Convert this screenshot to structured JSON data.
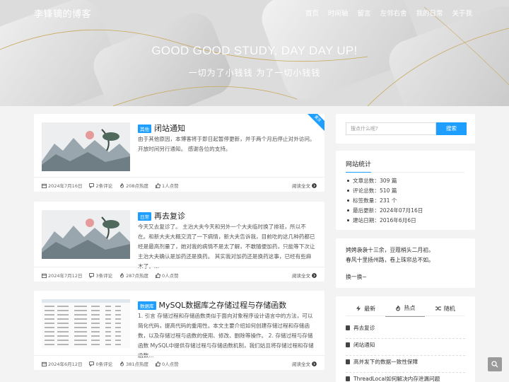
{
  "site": {
    "brand": "李锋镝的博客",
    "nav": [
      "首页",
      "时间轴",
      "留言",
      "左邻右舍",
      "我的日常",
      "关于我"
    ],
    "hero_title": "GOOD GOOD STUDY, DAY DAY UP!",
    "hero_subtitle": "一切为了小钱钱 为了一切小钱钱"
  },
  "posts": [
    {
      "category": "其他",
      "title": "闭站通知",
      "excerpt": "由于其他原因，本博客将于即日起暂停更新，并于两个月后停止对外访问。开放时间另行通知。 感谢各位的支持。",
      "date": "2024年7月16日",
      "comments": "2条评论",
      "heat": "208点热度",
      "likes": "1人点赞",
      "read_more": "阅读全文",
      "corner_badge": "置顶"
    },
    {
      "category": "日常",
      "title": "再去复诊",
      "excerpt": "今天又去复诊了。 主治大夫今天和另外一个大夫临时换了排班，所以不在。和新大夫大概交流了一下病情，新大夫告诉我，目前吃的这几种药都已经是最高剂量了，她对我的病情不是太了解，不敢随便加药，只能等下次让主治大夫确认是加药还是换药。 其实我对加药还是换药这事，已经有些麻木了，...",
      "date": "2024年7月12日",
      "comments": "3条评论",
      "heat": "287点热度",
      "likes": "0人点赞",
      "read_more": "阅读全文"
    },
    {
      "category": "数据库",
      "title": "MySQL数据库之存储过程与存储函数",
      "excerpt": "1. 引言 存储过程和存储函数类似于面向对象程序设计语言中的方法，可以简化代码，提高代码的重用性。本文主要介绍如何创建存储过程和存储函数，以及存储过程与函数的使用、修改、删除等操作。 2. 存储过程与存储函数 MySQL中提供存储过程与存储函数机制，我们姑且将存储过程和存储函数...",
      "date": "2024年6月12日",
      "comments": "0条评论",
      "heat": "381点热度",
      "likes": "0人点赞",
      "read_more": "阅读全文"
    }
  ],
  "sidebar": {
    "search_placeholder": "搜点什么呢?",
    "search_button": "搜索",
    "stats_title": "网站统计",
    "stats": [
      "文章总数：309 篇",
      "评论总数：510 篇",
      "标签数量：231 个",
      "最后更新：2024年07月16日",
      "建站日期：2016年6月6日"
    ],
    "poem": [
      "娉娉袅袅十三余，豆蔻梢头二月初。",
      "春风十里扬州路，卷上珠帘总不如。"
    ],
    "poem_action": "换一换~",
    "tabs": [
      "最新",
      "热点",
      "随机"
    ],
    "active_tab": "热点",
    "hot_posts": [
      "再去复诊",
      "闭站通知",
      "高并发下的数据一致性保障",
      "ThreadLocal如何解决内存泄漏问题"
    ]
  },
  "colors": {
    "accent": "#1e9fff",
    "background": "#f3f3f3"
  }
}
